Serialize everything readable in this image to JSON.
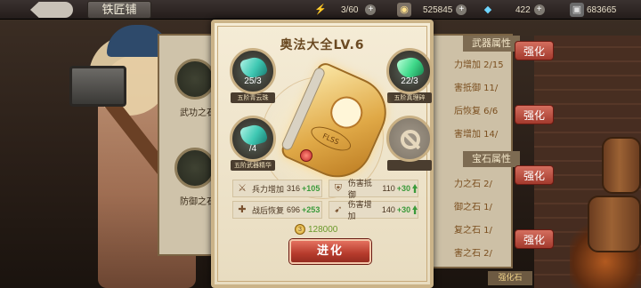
{
  "header": {
    "back_label": "",
    "title": "铁匠铺",
    "resources": [
      {
        "icon": "lightning-icon",
        "value": "3/60"
      },
      {
        "icon": "gold-icon",
        "value": "525845"
      },
      {
        "icon": "diamond-icon",
        "value": "422"
      },
      {
        "icon": "stone-icon",
        "value": "683665"
      }
    ]
  },
  "background": {
    "left_items": [
      "武功之石",
      "防御之石"
    ],
    "right_sections": [
      {
        "title": "武器属性",
        "rows": [
          "力增加 2/15",
          "害抵御 11/",
          "后恢复 6/6",
          "害增加 14/"
        ]
      },
      {
        "title": "宝石属性",
        "rows": [
          "力之石 2/",
          "御之石 1/",
          "复之石 1/",
          "害之石 2/"
        ]
      }
    ],
    "refine_label": "强化",
    "bottom_tab": "强化石"
  },
  "modal": {
    "title": "奥法大全LV.6",
    "book_tag": "FLSS",
    "materials": [
      {
        "name": "五阶青云珠",
        "count": "25/3"
      },
      {
        "name": "五阶真理碎",
        "count": "22/3"
      },
      {
        "name": "五阶武器精华",
        "count": "/4"
      },
      {
        "name": "",
        "count": ""
      }
    ],
    "stats": [
      {
        "icon": "sword-icon",
        "name": "兵力增加",
        "value": "316",
        "add": "+105"
      },
      {
        "icon": "shield-icon",
        "name": "伤害抵御",
        "value": "110",
        "add": "+30"
      },
      {
        "icon": "heal-icon",
        "name": "战后恢复",
        "value": "696",
        "add": "+253"
      },
      {
        "icon": "damage-icon",
        "name": "伤害增加",
        "value": "140",
        "add": "+30"
      }
    ],
    "cost_coin": "3",
    "cost": "128000",
    "evolve_label": "进化"
  },
  "colors": {
    "accent_gold": "#cbb388",
    "evolve_red": "#b63b2c",
    "gain_green": "#3a9a3a"
  }
}
